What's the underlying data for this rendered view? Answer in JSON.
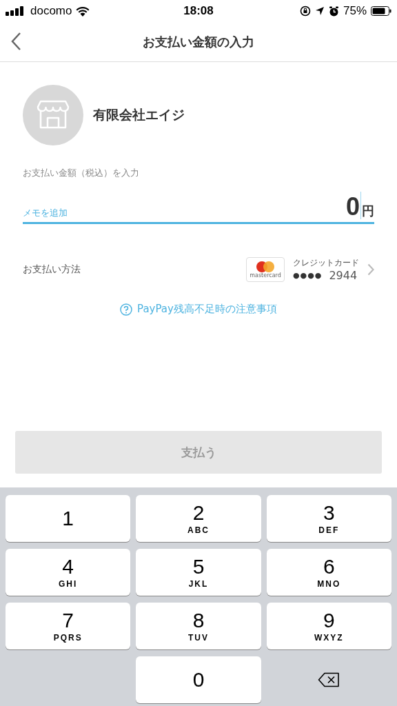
{
  "status_bar": {
    "carrier": "docomo",
    "time": "18:08",
    "battery": "75%"
  },
  "nav": {
    "title": "お支払い金額の入力"
  },
  "merchant": {
    "name": "有限会社エイジ"
  },
  "amount": {
    "label": "お支払い金額（税込）を入力",
    "memo_placeholder": "メモを追加",
    "value": "0",
    "unit": "円"
  },
  "payment": {
    "label": "お支払い方法",
    "card_brand": "mastercard",
    "card_type": "クレジットカード",
    "card_mask": "●●●●",
    "card_last4": "2944"
  },
  "help_link": "PayPay残高不足時の注意事項",
  "pay_button": {
    "label": "支払う",
    "disabled": true
  },
  "keypad": [
    {
      "kind": "digit",
      "digit": "1"
    },
    {
      "kind": "digit",
      "digit": "2",
      "letters": "ABC"
    },
    {
      "kind": "digit",
      "digit": "3",
      "letters": "DEF"
    },
    {
      "kind": "digit",
      "digit": "4",
      "letters": "GHI"
    },
    {
      "kind": "digit",
      "digit": "5",
      "letters": "JKL"
    },
    {
      "kind": "digit",
      "digit": "6",
      "letters": "MNO"
    },
    {
      "kind": "digit",
      "digit": "7",
      "letters": "PQRS"
    },
    {
      "kind": "digit",
      "digit": "8",
      "letters": "TUV"
    },
    {
      "kind": "digit",
      "digit": "9",
      "letters": "WXYZ"
    },
    {
      "kind": "blank"
    },
    {
      "kind": "digit",
      "digit": "0"
    },
    {
      "kind": "delete"
    }
  ]
}
